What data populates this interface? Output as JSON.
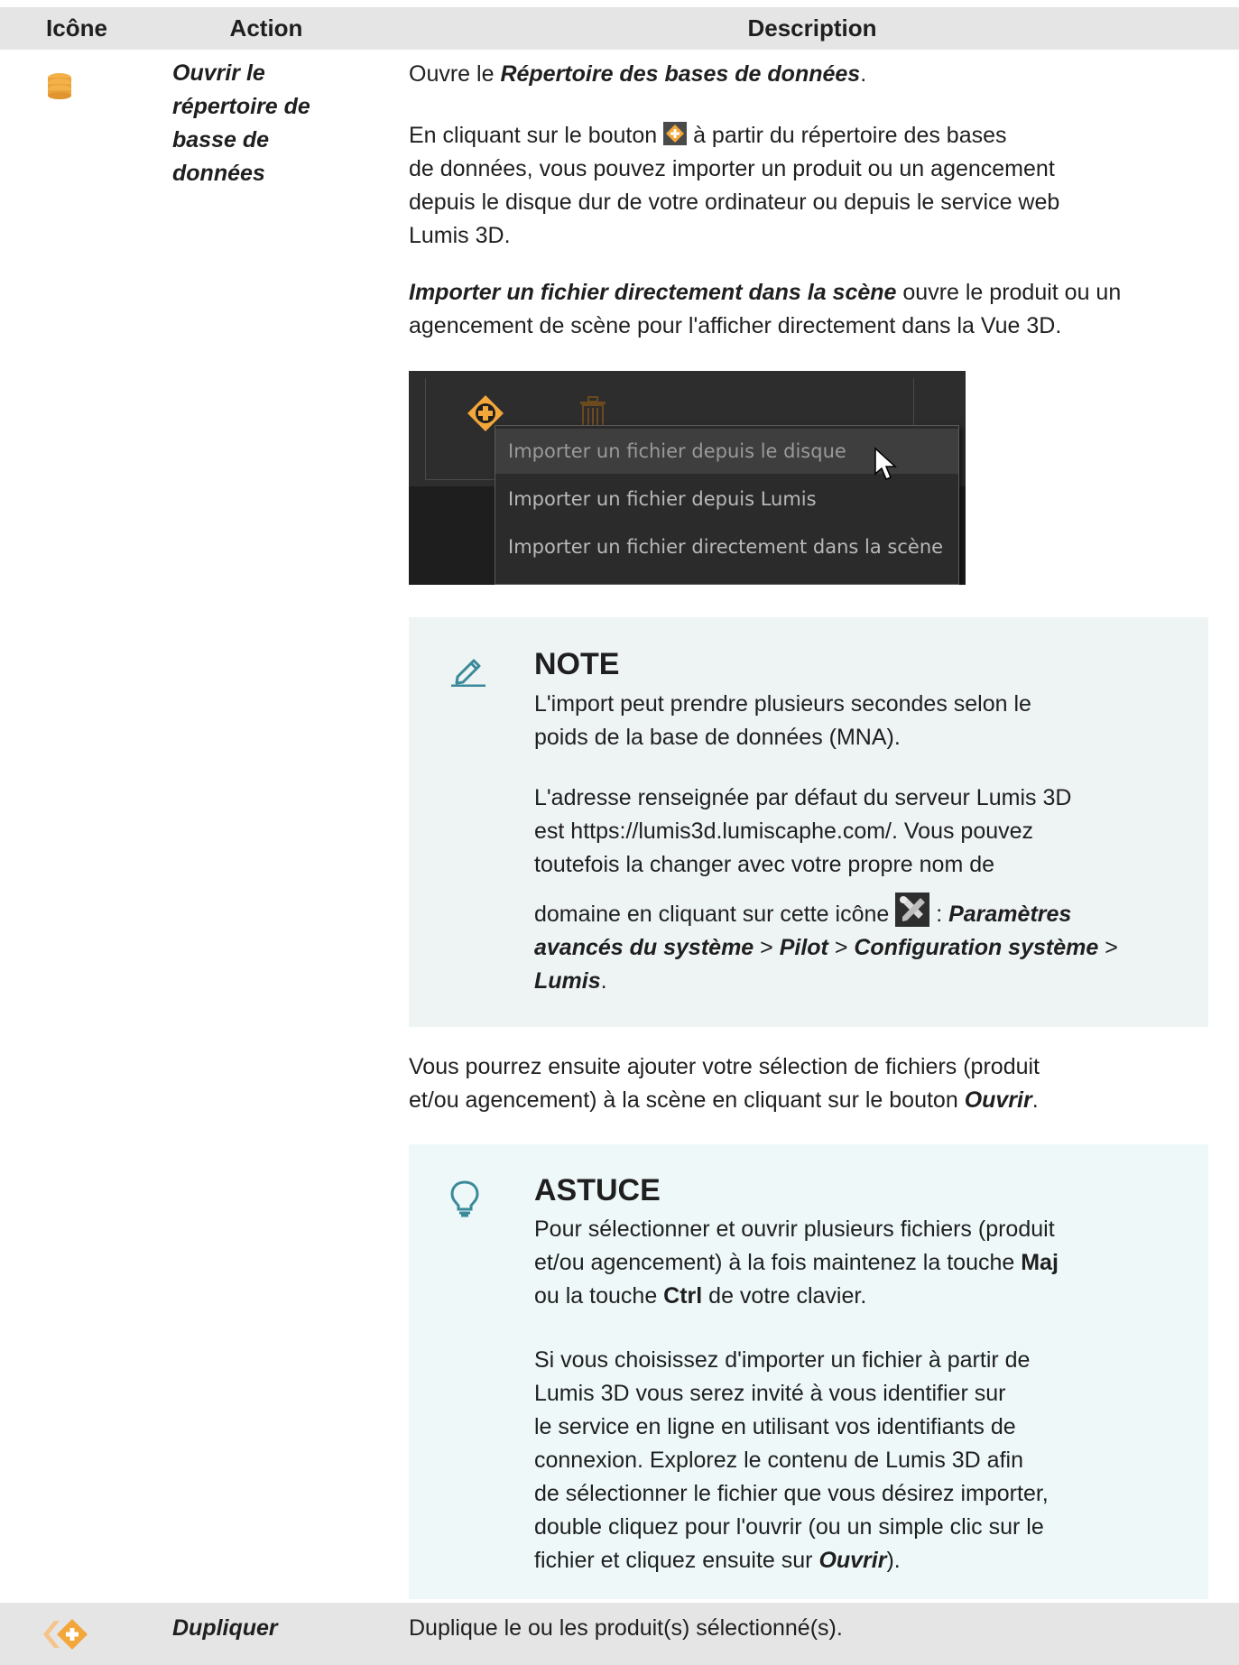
{
  "header": {
    "col_icon": "Icône",
    "col_action": "Action",
    "col_description": "Description"
  },
  "row1": {
    "icon": "database-icon",
    "action_lines": [
      "Ouvrir le",
      "répertoire de",
      "basse de",
      "données"
    ],
    "p1_pre": "Ouvre le ",
    "p1_em": "Répertoire des bases de données",
    "p1_post": ".",
    "p2_pre": "En cliquant sur le bouton ",
    "p2_line1_post": " à partir du répertoire des bases",
    "p2_line2": "de données, vous pouvez importer un produit ou un agencement",
    "p2_line3": "depuis le disque dur de votre ordinateur ou depuis le service web",
    "p2_line4": "Lumis 3D.",
    "p3_em": "Importer un fichier directement dans la scène",
    "p3_line1_post": " ouvre le produit ou un",
    "p3_line2": "agencement de scène pour l'afficher directement dans la Vue 3D.",
    "menu": [
      "Importer un fichier depuis le disque",
      "Importer un fichier depuis Lumis",
      "Importer un fichier directement dans la scène"
    ],
    "note": {
      "title": "NOTE",
      "l1": "L'import peut prendre plusieurs secondes selon le",
      "l2": "poids de la base de données (MNA).",
      "l3": "L'adresse renseignée par défaut du serveur Lumis 3D",
      "l4": "est https://lumis3d.lumiscaphe.com/. Vous pouvez",
      "l5": "toutefois la changer avec votre propre nom de",
      "l6_pre": "domaine en cliquant sur cette icône ",
      "l6_sep": " : ",
      "l6_em": "Paramètres",
      "l7_em1": "avancés du système",
      "gt": " > ",
      "l7_em2": "Pilot",
      "l7_em3": "Configuration système",
      "l7_gt_end": " >",
      "l8_em": "Lumis",
      "l8_post": "."
    },
    "after_note_l1": "Vous pourrez ensuite ajouter votre sélection de fichiers (produit",
    "after_note_l2_pre": "et/ou agencement) à la scène en cliquant sur le bouton ",
    "after_note_l2_em": "Ouvrir",
    "after_note_l2_post": ".",
    "tip": {
      "title": "ASTUCE",
      "l1": "Pour sélectionner et ouvrir plusieurs fichiers (produit",
      "l2_pre": "et/ou agencement) à la fois maintenez la touche ",
      "l2_b": "Maj",
      "l3_pre": "ou la touche ",
      "l3_b": "Ctrl",
      "l3_post": " de votre clavier.",
      "l4": "Si vous choisissez d'importer un fichier à partir de",
      "l5": "Lumis 3D vous serez invité à vous identifier sur",
      "l6": "le service en ligne en utilisant vos identifiants de",
      "l7": "connexion. Explorez le contenu de Lumis 3D afin",
      "l8": "de sélectionner le fichier que vous désirez importer,",
      "l9": "double cliquez pour l'ouvrir (ou un simple clic sur le",
      "l10_pre": "fichier et cliquez ensuite sur ",
      "l10_em": "Ouvrir",
      "l10_post": ")."
    }
  },
  "row2": {
    "icon": "duplicate-icon",
    "action": "Dupliquer",
    "desc": "Duplique le ou les produit(s) sélectionné(s)."
  },
  "colors": {
    "accent_orange": "#f0a030",
    "note_bg": "#eef3f4",
    "tip_bg": "#eef8f9",
    "header_bg": "#e5e5e5",
    "icon_teal": "#3a8a99"
  }
}
